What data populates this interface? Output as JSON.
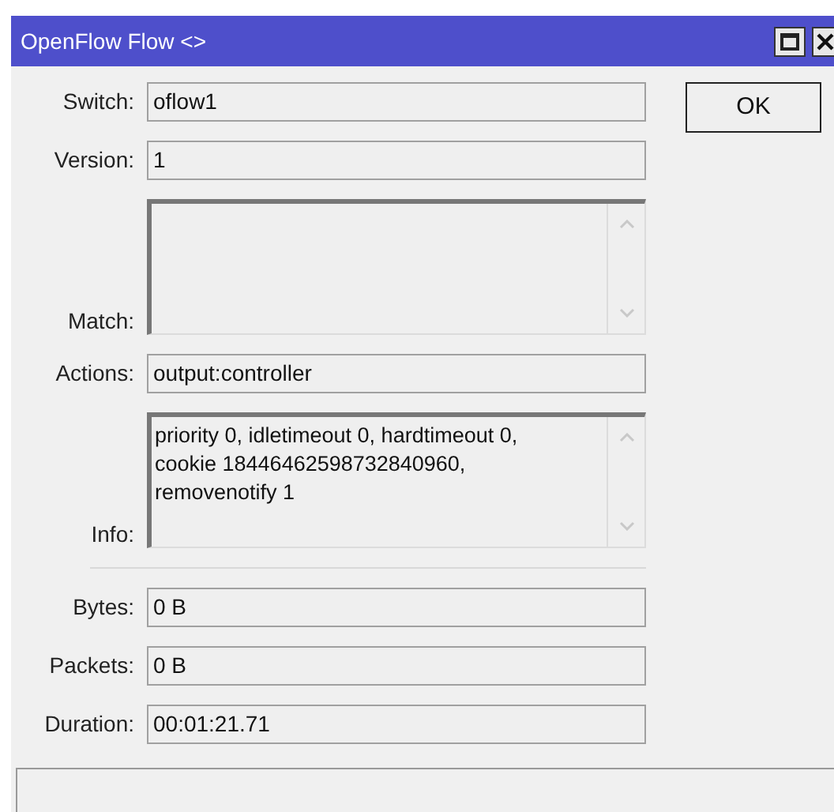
{
  "window": {
    "title": "OpenFlow Flow <>"
  },
  "fields": [
    {
      "label": "Switch:",
      "kind": "line",
      "value": "oflow1"
    },
    {
      "label": "Version:",
      "kind": "line",
      "value": "1"
    },
    {
      "label": "Match:",
      "kind": "area"
    },
    {
      "label": "Actions:",
      "kind": "line",
      "value": "output:controller"
    },
    {
      "label": "Info:",
      "kind": "area",
      "value": "priority 0, idletimeout 0, hardtimeout 0, cookie 18446462598732840960, removenotify 1"
    }
  ],
  "stats": [
    {
      "label": "Bytes:",
      "value": "0 B"
    },
    {
      "label": "Packets:",
      "value": "0 B"
    },
    {
      "label": "Duration:",
      "value": "00:01:21.71"
    }
  ],
  "buttons": [
    "OK"
  ]
}
